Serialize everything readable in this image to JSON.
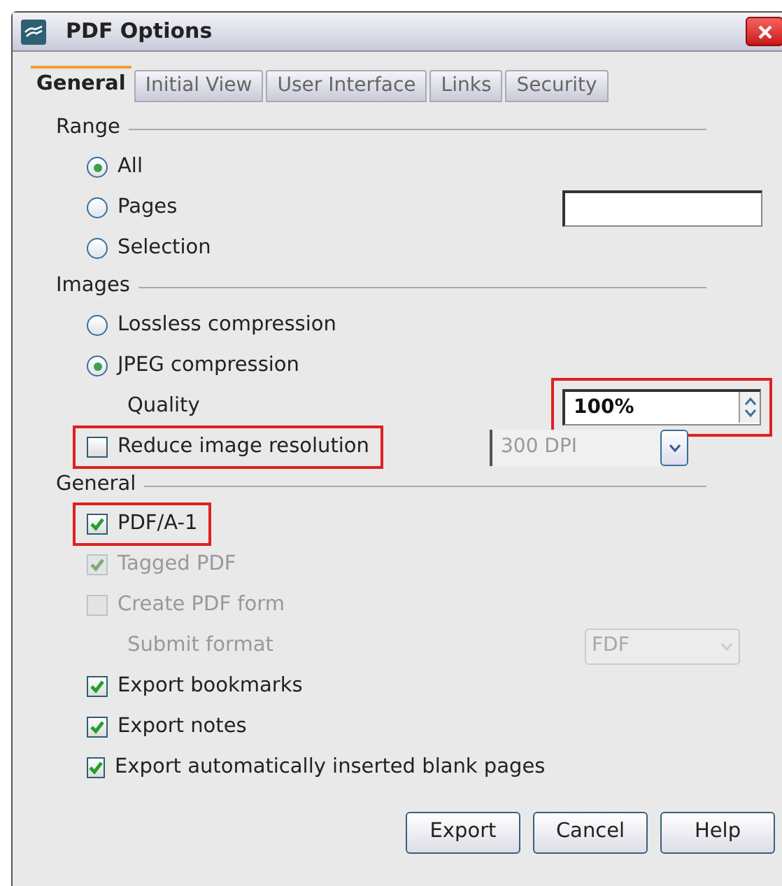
{
  "window": {
    "title": "PDF Options"
  },
  "tabs": [
    {
      "label": "General",
      "selected": true
    },
    {
      "label": "Initial View",
      "selected": false
    },
    {
      "label": "User Interface",
      "selected": false
    },
    {
      "label": "Links",
      "selected": false
    },
    {
      "label": "Security",
      "selected": false
    }
  ],
  "sections": [
    {
      "title": "Range",
      "rows": [
        {
          "kind": "radio",
          "label": "All",
          "selected": true
        },
        {
          "kind": "radio",
          "label": "Pages",
          "selected": false,
          "field": true
        },
        {
          "kind": "radio",
          "label": "Selection",
          "selected": false
        }
      ]
    },
    {
      "title": "Images",
      "rows": [
        {
          "kind": "radio",
          "label": "Lossless compression",
          "selected": false
        },
        {
          "kind": "radio",
          "label": "JPEG compression",
          "selected": true
        },
        {
          "kind": "spin",
          "label": "Quality",
          "value": "100%",
          "highlighted": true
        },
        {
          "kind": "checkbox",
          "label": "Reduce image resolution",
          "checked": false,
          "highlighted": true,
          "dropdown": {
            "value": "300 DPI",
            "disabled": true
          }
        }
      ]
    },
    {
      "title": "General",
      "rows": [
        {
          "kind": "checkbox",
          "label": "PDF/A-1",
          "checked": true,
          "highlighted": true
        },
        {
          "kind": "checkbox",
          "label": "Tagged PDF",
          "checked": true,
          "disabled": true
        },
        {
          "kind": "checkbox",
          "label": "Create PDF form",
          "checked": false,
          "disabled": true
        },
        {
          "kind": "select",
          "label": "Submit format",
          "value": "FDF",
          "disabled": true
        },
        {
          "kind": "checkbox",
          "label": "Export bookmarks",
          "checked": true
        },
        {
          "kind": "checkbox",
          "label": "Export notes",
          "checked": true
        },
        {
          "kind": "checkbox",
          "label": "Export automatically inserted blank pages",
          "checked": true
        }
      ]
    }
  ],
  "buttons": [
    "Export",
    "Cancel",
    "Help"
  ]
}
